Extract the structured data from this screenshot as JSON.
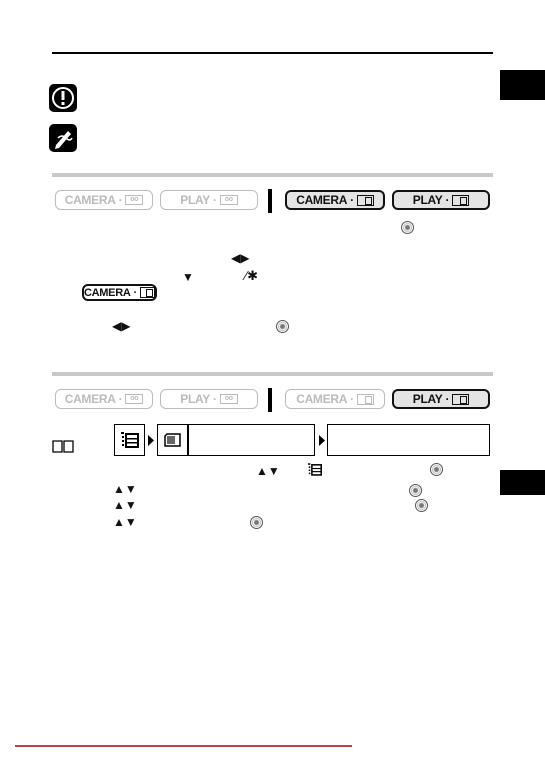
{
  "section1": {
    "buttons": [
      {
        "label": "CAMERA",
        "media": "tape",
        "active": false
      },
      {
        "label": "PLAY",
        "media": "tape",
        "active": false
      },
      {
        "label": "CAMERA",
        "media": "card",
        "active": true
      },
      {
        "label": "PLAY",
        "media": "card",
        "active": true
      }
    ],
    "inline_button": {
      "label": "CAMERA",
      "media": "card"
    }
  },
  "section2": {
    "buttons": [
      {
        "label": "CAMERA",
        "media": "tape",
        "active": false
      },
      {
        "label": "PLAY",
        "media": "tape",
        "active": false
      },
      {
        "label": "CAMERA",
        "media": "card",
        "active": false
      },
      {
        "label": "PLAY",
        "media": "card",
        "active": true
      }
    ]
  },
  "icons": {
    "caution": "caution-icon",
    "note": "pencil-note-icon",
    "joystick": "joystick-icon",
    "book": "book-reference-icon",
    "menu": "menu-icon",
    "trash": "erase-icon"
  },
  "colors": {
    "footer_rule": "#c0404f",
    "separator": "#c8c8c8"
  }
}
